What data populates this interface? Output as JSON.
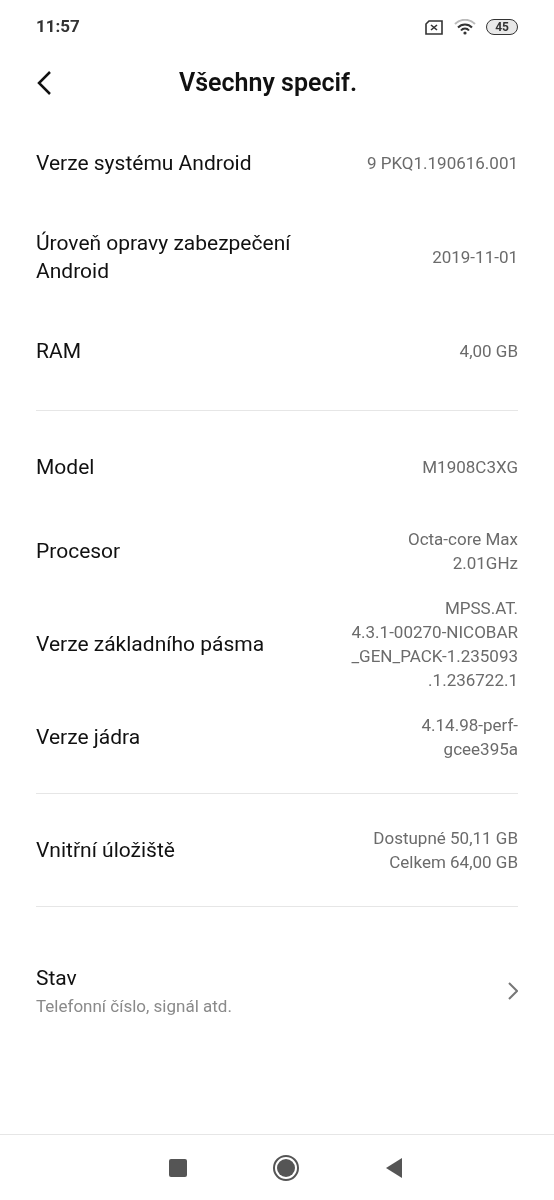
{
  "status_bar": {
    "time": "11:57",
    "battery": "45"
  },
  "header": {
    "title": "Všechny specif."
  },
  "sections": [
    {
      "rows": [
        {
          "label": "Verze systému Android",
          "value": [
            "9 PKQ1.190616.001"
          ]
        },
        {
          "label": "Úroveň opravy zabezpečení Android",
          "value": [
            "2019-11-01"
          ]
        },
        {
          "label": "RAM",
          "value": [
            "4,00 GB"
          ]
        }
      ]
    },
    {
      "rows": [
        {
          "label": "Model",
          "value": [
            "M1908C3XG"
          ]
        },
        {
          "label": "Procesor",
          "value": [
            "Octa-core Max",
            "2.01GHz"
          ]
        },
        {
          "label": "Verze základního pásma",
          "value": [
            "MPSS.AT.",
            "4.3.1-00270-NICOBAR",
            "_GEN_PACK-1.235093",
            ".1.236722.1"
          ]
        },
        {
          "label": "Verze jádra",
          "value": [
            "4.14.98-perf-",
            "gcee395a"
          ]
        }
      ]
    },
    {
      "rows": [
        {
          "label": "Vnitřní úložiště",
          "value": [
            "Dostupné 50,11 GB",
            "Celkem 64,00 GB"
          ]
        }
      ]
    }
  ],
  "status_link": {
    "title": "Stav",
    "subtitle": "Telefonní číslo, signál atd."
  }
}
